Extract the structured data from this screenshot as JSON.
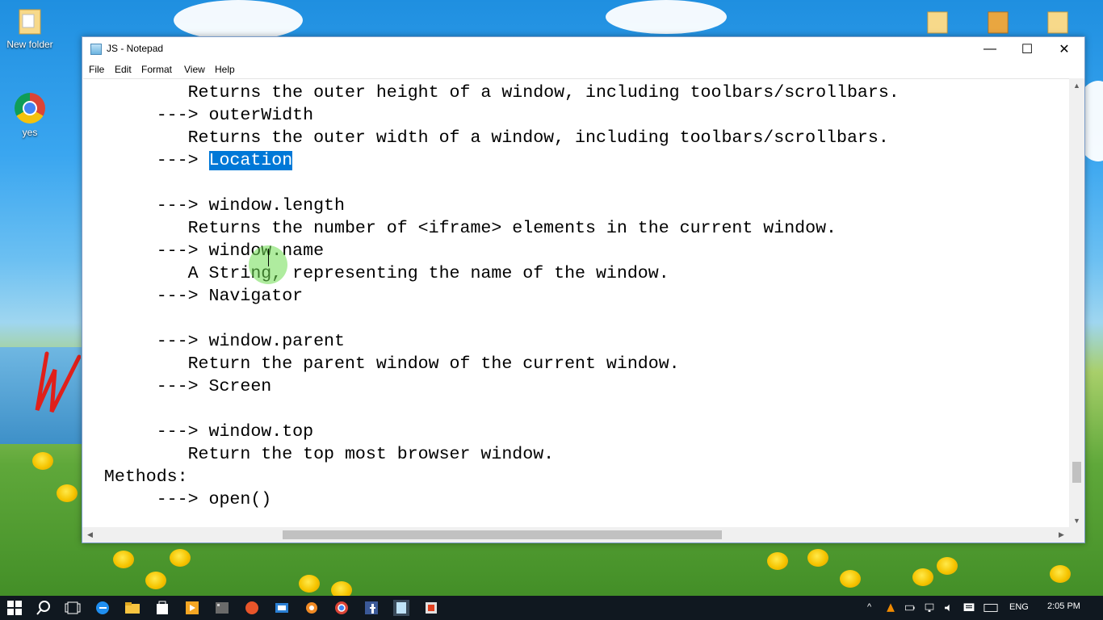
{
  "desktop": {
    "icons": [
      {
        "label": "New folder"
      },
      {
        "label": "yes"
      }
    ]
  },
  "window": {
    "title": "JS - Notepad",
    "controls": {
      "minimize": "—",
      "maximize": "☐",
      "close": "✕"
    },
    "menu": [
      "File",
      "Edit",
      "Format",
      "View",
      "Help"
    ]
  },
  "editor": {
    "lines": [
      "          Returns the outer height of a window, including toolbars/scrollbars.",
      "       ---> outerWidth",
      "          Returns the outer width of a window, including toolbars/scrollbars.",
      "       ---> ",
      "",
      "       ---> window.length",
      "          Returns the number of <iframe> elements in the current window.",
      "       ---> window.name",
      "          A String, representing the name of the window.",
      "       ---> Navigator",
      "",
      "       ---> window.parent",
      "          Return the parent window of the current window.",
      "       ---> Screen",
      "",
      "       ---> window.top",
      "          Return the top most browser window.",
      "  Methods:",
      "       ---> open()"
    ],
    "selected_text": "Location",
    "selection_color": "#0078d7"
  },
  "taskbar": {
    "language": "ENG",
    "time": "2:05 PM"
  }
}
